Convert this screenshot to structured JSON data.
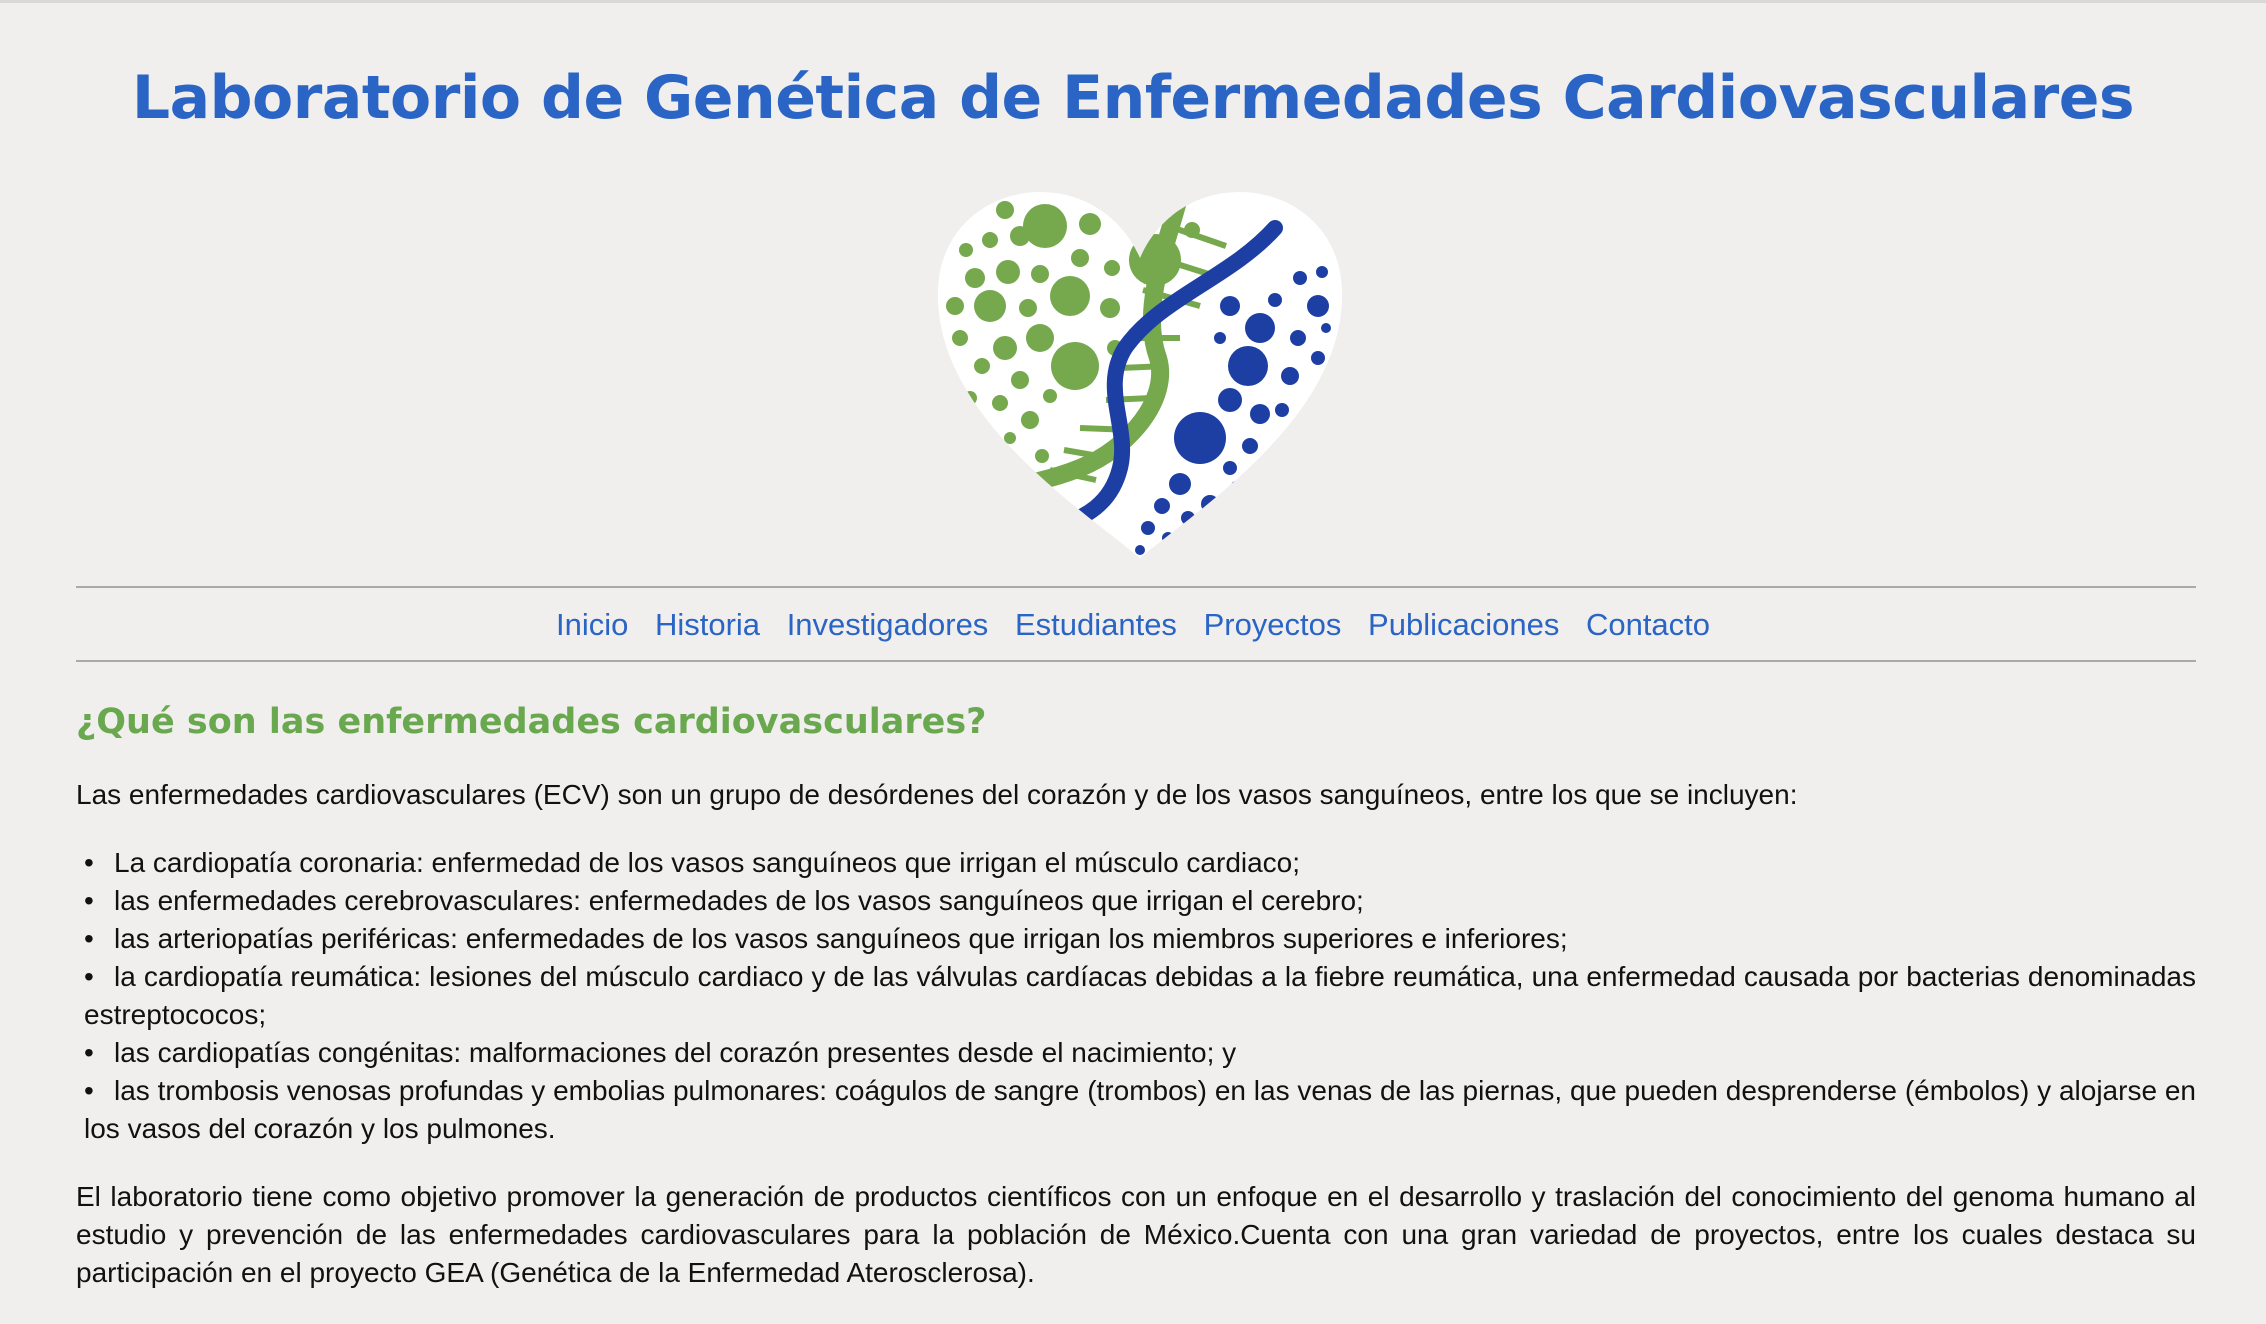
{
  "header": {
    "title": "Laboratorio de Genética de Enfermedades Cardiovasculares"
  },
  "logo": {
    "name": "heart-dna-logo",
    "colors": {
      "green": "#76a84e",
      "blue": "#1d3fa3"
    }
  },
  "nav": {
    "items": [
      {
        "label": "Inicio"
      },
      {
        "label": "Historia"
      },
      {
        "label": "Investigadores"
      },
      {
        "label": "Estudiantes"
      },
      {
        "label": "Proyectos"
      },
      {
        "label": "Publicaciones"
      },
      {
        "label": "Contacto"
      }
    ],
    "link_color": "#2a64c4"
  },
  "main": {
    "heading": "¿Qué son las enfermedades cardiovasculares?",
    "intro": "Las enfermedades cardiovasculares (ECV) son un grupo de desórdenes del corazón y de los vasos sanguíneos, entre los que se incluyen:",
    "bullet": "•",
    "list": [
      "La cardiopatía coronaria: enfermedad de los vasos sanguíneos que irrigan el músculo cardiaco;",
      "las enfermedades cerebrovasculares: enfermedades de los vasos sanguíneos que irrigan el cerebro;",
      "las arteriopatías periféricas: enfermedades de los vasos sanguíneos que irrigan los miembros superiores e inferiores;",
      "la cardiopatía reumática: lesiones del músculo cardiaco y de las válvulas cardíacas debidas a la fiebre reumática, una enfermedad causada por bacterias denominadas estreptococos;",
      "las cardiopatías congénitas: malformaciones del corazón presentes desde el nacimiento; y",
      "las trombosis venosas profundas y embolias pulmonares: coágulos de sangre (trombos) en las venas de las piernas, que pueden desprenderse (émbolos) y alojarse en los vasos del corazón y los pulmones."
    ],
    "closing": "El laboratorio tiene como objetivo promover la generación de productos científicos con un enfoque en el desarrollo y traslación del conocimiento del genoma humano al estudio y prevención de las enfermedades cardiovasculares para la población de México.Cuenta con una gran variedad de proyectos, entre los cuales destaca su participación en el proyecto GEA (Genética de la Enfermedad Aterosclerosa)."
  },
  "colors": {
    "title": "#2a64c4",
    "heading": "#6aa84f",
    "background": "#f0efee"
  }
}
